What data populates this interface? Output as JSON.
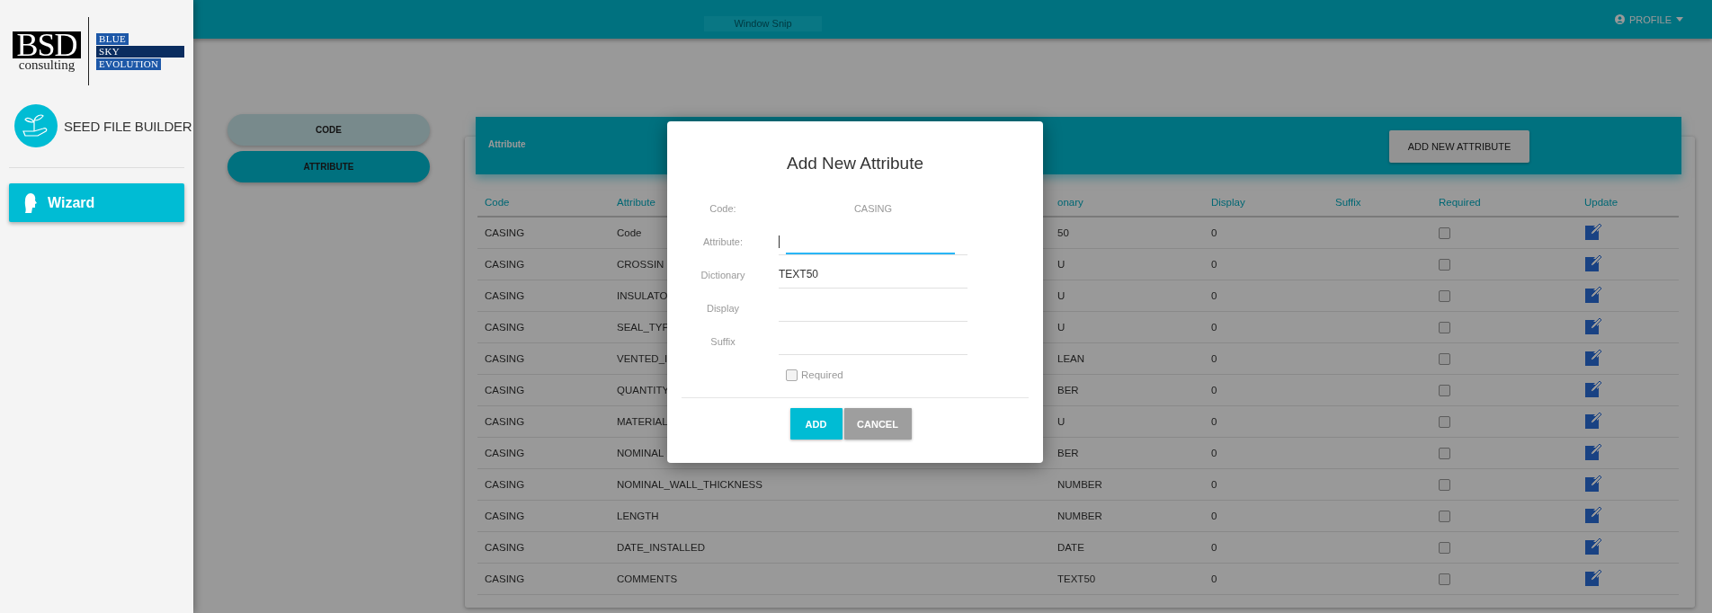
{
  "top_bar": {
    "snip_label": "Window Snip",
    "profile": "PROFILE"
  },
  "sidebar": {
    "logo": {
      "mark": "BSD",
      "subtitle": "consulting",
      "words": [
        "BLUE",
        "SKY",
        "EVOLUTION"
      ]
    },
    "app_name": "SEED FILE BUILDER",
    "nav": [
      {
        "label": "Wizard",
        "selected": true
      }
    ]
  },
  "tabs": [
    {
      "label": "CODE",
      "selected": false
    },
    {
      "label": "ATTRIBUTE",
      "selected": true
    }
  ],
  "card": {
    "title": "Attribute",
    "add_button": "ADD NEW ATTRIBUTE"
  },
  "table": {
    "columns": [
      "Code",
      "Attribute",
      "onary",
      "Display",
      "Suffix",
      "Required",
      "Update"
    ],
    "rows": [
      {
        "code": "CASING",
        "attribute": "Code",
        "dictionary": "50",
        "display": "0",
        "required": false
      },
      {
        "code": "CASING",
        "attribute": "CROSSIN",
        "dictionary": "U",
        "display": "0",
        "required": false
      },
      {
        "code": "CASING",
        "attribute": "INSULATO",
        "dictionary": "U",
        "display": "0",
        "required": false
      },
      {
        "code": "CASING",
        "attribute": "SEAL_TYP",
        "dictionary": "U",
        "display": "0",
        "required": false
      },
      {
        "code": "CASING",
        "attribute": "VENTED_I",
        "dictionary": "LEAN",
        "display": "0",
        "required": false
      },
      {
        "code": "CASING",
        "attribute": "QUANTITY",
        "dictionary": "BER",
        "display": "0",
        "required": false
      },
      {
        "code": "CASING",
        "attribute": "MATERIAL",
        "dictionary": "U",
        "display": "0",
        "required": false
      },
      {
        "code": "CASING",
        "attribute": "NOMINAL",
        "dictionary": "BER",
        "display": "0",
        "required": false
      },
      {
        "code": "CASING",
        "attribute": "NOMINAL_WALL_THICKNESS",
        "dictionary": "NUMBER",
        "display": "0",
        "required": false
      },
      {
        "code": "CASING",
        "attribute": "LENGTH",
        "dictionary": "NUMBER",
        "display": "0",
        "required": false
      },
      {
        "code": "CASING",
        "attribute": "DATE_INSTALLED",
        "dictionary": "DATE",
        "display": "0",
        "required": false
      },
      {
        "code": "CASING",
        "attribute": "COMMENTS",
        "dictionary": "TEXT50",
        "display": "0",
        "required": false
      }
    ]
  },
  "dialog": {
    "title": "Add New Attribute",
    "fields": [
      {
        "label": "Code:",
        "kind": "static",
        "value": "CASING"
      },
      {
        "label": "Attribute:",
        "kind": "input",
        "focused": true
      },
      {
        "label": "Dictionary",
        "kind": "input",
        "value": "TEXT50",
        "focused": false
      },
      {
        "label": "Display",
        "kind": "input",
        "focused": false
      },
      {
        "label": "Suffix",
        "kind": "input",
        "focused": false
      }
    ],
    "required": {
      "label": "Required",
      "checked": false
    },
    "buttons": [
      {
        "label": "ADD",
        "kind": "primary"
      },
      {
        "label": "CANCEL",
        "kind": "secondary"
      }
    ]
  }
}
